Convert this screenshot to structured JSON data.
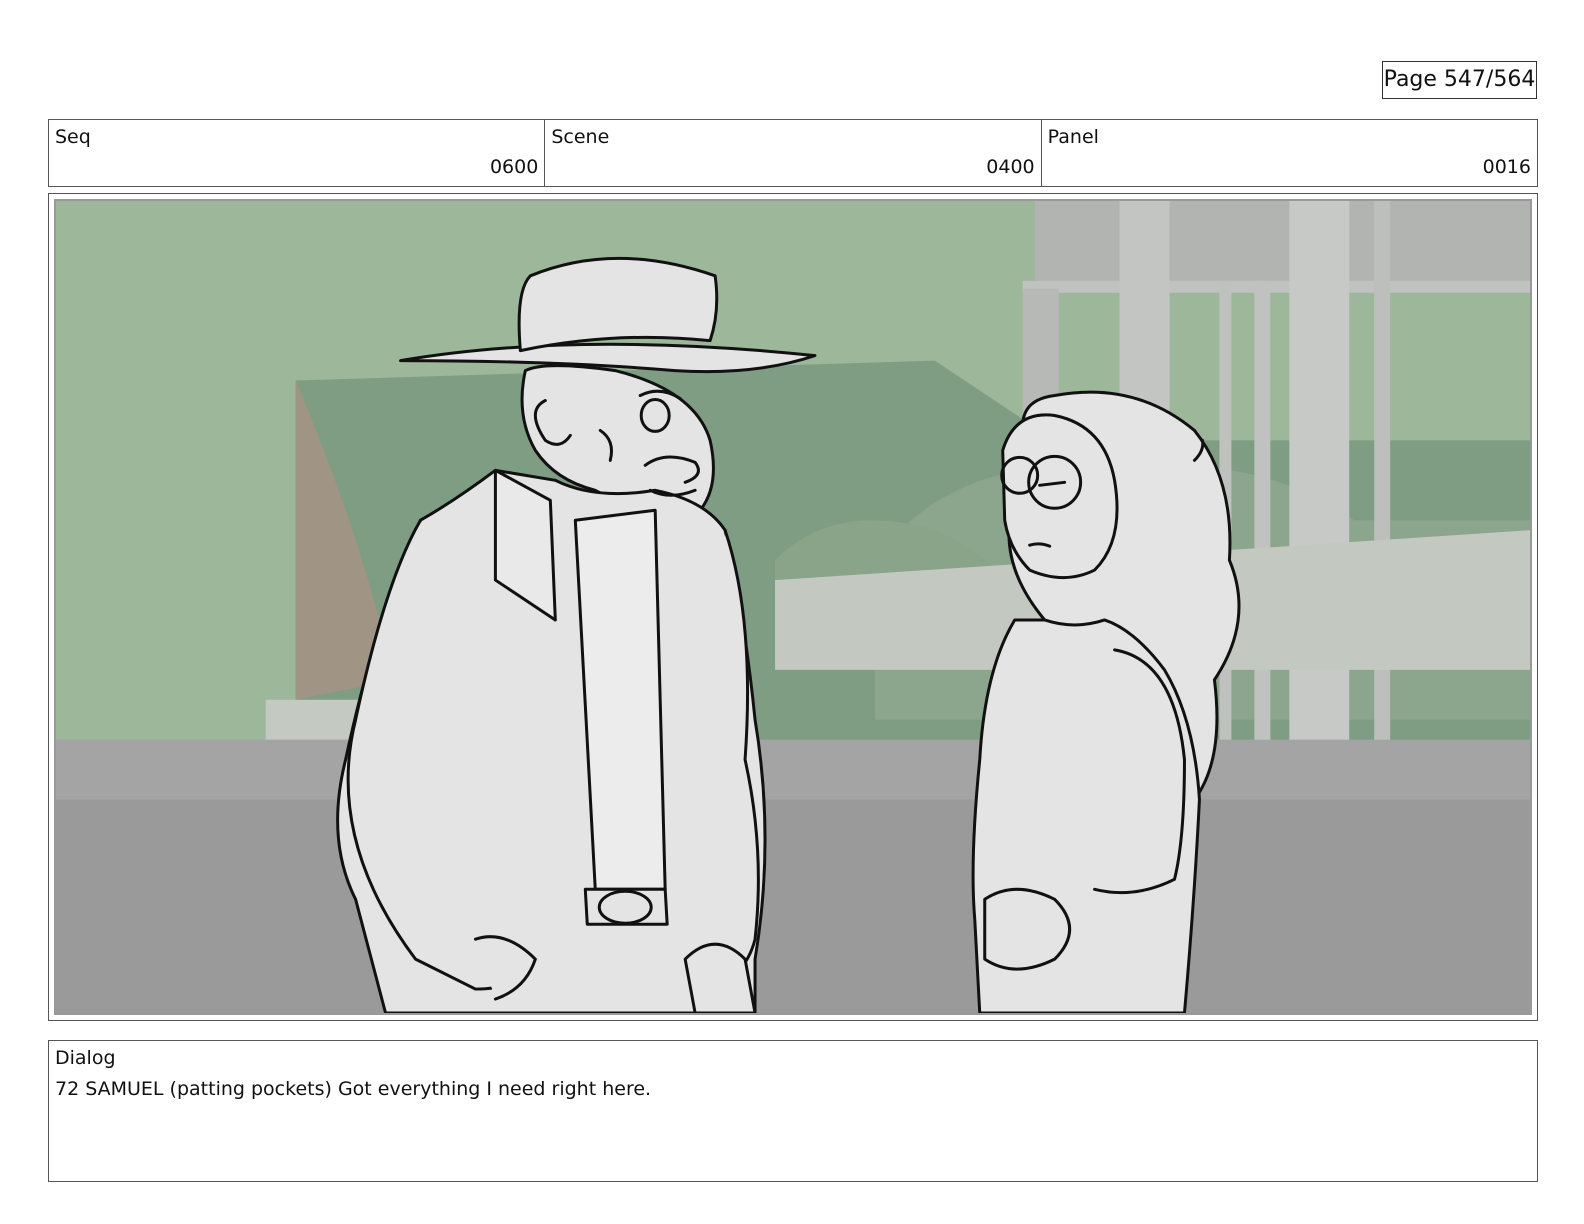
{
  "page": {
    "label": "Page 547/564"
  },
  "header": {
    "seq": {
      "label": "Seq",
      "value": "0600"
    },
    "scene": {
      "label": "Scene",
      "value": "0400"
    },
    "panel": {
      "label": "Panel",
      "value": "0016"
    }
  },
  "dialog": {
    "label": "Dialog",
    "text": "72 SAMUEL (patting pockets) Got everything I need right here."
  }
}
